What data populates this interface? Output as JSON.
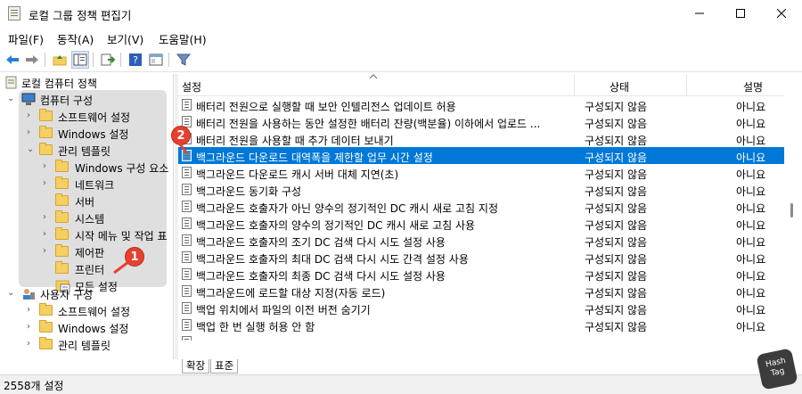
{
  "window": {
    "title": "로컬 그룹 정책 편집기"
  },
  "menu": [
    "파일(F)",
    "동작(A)",
    "보기(V)",
    "도움말(H)"
  ],
  "toolbar": {
    "icons": [
      "back-icon",
      "forward-icon",
      "up-folder-icon",
      "show-hide-tree-icon",
      "export-list-icon",
      "help-icon",
      "view-icon",
      "filter-icon"
    ]
  },
  "tree": [
    {
      "label": "로컬 컴퓨터 정책",
      "level": 0,
      "icon": "policy-icon",
      "chevron": ""
    },
    {
      "label": "컴퓨터 구성",
      "level": 1,
      "icon": "computer-icon",
      "chevron": "expanded"
    },
    {
      "label": "소프트웨어 설정",
      "level": 2,
      "icon": "folder-icon",
      "chevron": "collapsed"
    },
    {
      "label": "Windows 설정",
      "level": 2,
      "icon": "folder-icon",
      "chevron": "collapsed"
    },
    {
      "label": "관리 템플릿",
      "level": 2,
      "icon": "folder-icon",
      "chevron": "expanded"
    },
    {
      "label": "Windows 구성 요소",
      "level": 3,
      "icon": "folder-icon",
      "chevron": "collapsed"
    },
    {
      "label": "네트워크",
      "level": 3,
      "icon": "folder-icon",
      "chevron": "collapsed"
    },
    {
      "label": "서버",
      "level": 3,
      "icon": "folder-icon",
      "chevron": ""
    },
    {
      "label": "시스템",
      "level": 3,
      "icon": "folder-icon",
      "chevron": "collapsed"
    },
    {
      "label": "시작 메뉴 및 작업 표",
      "level": 3,
      "icon": "folder-icon",
      "chevron": "collapsed"
    },
    {
      "label": "제어판",
      "level": 3,
      "icon": "folder-icon",
      "chevron": "collapsed"
    },
    {
      "label": "프린터",
      "level": 3,
      "icon": "folder-icon",
      "chevron": ""
    },
    {
      "label": "모든 설정",
      "level": 3,
      "icon": "all-settings-icon",
      "chevron": ""
    },
    {
      "label": "사용자 구성",
      "level": 1,
      "icon": "user-icon",
      "chevron": "expanded"
    },
    {
      "label": "소프트웨어 설정",
      "level": 2,
      "icon": "folder-icon",
      "chevron": "collapsed"
    },
    {
      "label": "Windows 설정",
      "level": 2,
      "icon": "folder-icon",
      "chevron": "collapsed"
    },
    {
      "label": "관리 템플릿",
      "level": 2,
      "icon": "folder-icon",
      "chevron": "collapsed"
    }
  ],
  "list": {
    "headers": {
      "setting": "설정",
      "state": "상태",
      "comment": "설명"
    },
    "rows": [
      {
        "setting": "배터리 전원으로 실행할 때 보안 인텔리전스 업데이트 허용",
        "state": "구성되지 않음",
        "comment": "아니요"
      },
      {
        "setting": "배터리 전원을 사용하는 동안 설정한 배터리 잔량(백분율) 이하에서 업로드 ...",
        "state": "구성되지 않음",
        "comment": "아니요"
      },
      {
        "setting": "배터리 전원을 사용할 때 추가 데이터 보내기",
        "state": "구성되지 않음",
        "comment": "아니요"
      },
      {
        "setting": "백그라운드 다운로드 대역폭을 제한할 업무 시간 설정",
        "state": "구성되지 않음",
        "comment": "아니요",
        "selected": true
      },
      {
        "setting": "백그라운드 다운로드 캐시 서버 대체 지연(초)",
        "state": "구성되지 않음",
        "comment": "아니요"
      },
      {
        "setting": "백그라운드 동기화 구성",
        "state": "구성되지 않음",
        "comment": "아니요"
      },
      {
        "setting": "백그라운드 호출자가 아닌 양수의 정기적인 DC 캐시 새로 고침 지정",
        "state": "구성되지 않음",
        "comment": "아니요"
      },
      {
        "setting": "백그라운드 호출자의 양수의 정기적인 DC 캐시 새로 고침 사용",
        "state": "구성되지 않음",
        "comment": "아니요"
      },
      {
        "setting": "백그라운드 호출자의 조기 DC 검색 다시 시도 설정 사용",
        "state": "구성되지 않음",
        "comment": "아니요"
      },
      {
        "setting": "백그라운드 호출자의 최대 DC 검색 다시 시도 간격 설정 사용",
        "state": "구성되지 않음",
        "comment": "아니요"
      },
      {
        "setting": "백그라운드 호출자의 최종 DC 검색 다시 시도 설정 사용",
        "state": "구성되지 않음",
        "comment": "아니요"
      },
      {
        "setting": "백그라운드에 로드할 대상 지정(자동 로드)",
        "state": "구성되지 않음",
        "comment": "아니요"
      },
      {
        "setting": "백업 위치에서 파일의 이전 버전 숨기기",
        "state": "구성되지 않음",
        "comment": "아니요"
      },
      {
        "setting": "백업 한 번 실행 허용 안 함",
        "state": "구성되지 않음",
        "comment": "아니요"
      }
    ]
  },
  "tabs": [
    "확장",
    "표준"
  ],
  "status": {
    "text": "2558개 설정"
  },
  "callouts": [
    "1",
    "2"
  ],
  "watermark": {
    "line1": "Hash",
    "line2": "Tag"
  },
  "colors": {
    "selection": "#0078d7",
    "badge": "#e4412e"
  }
}
